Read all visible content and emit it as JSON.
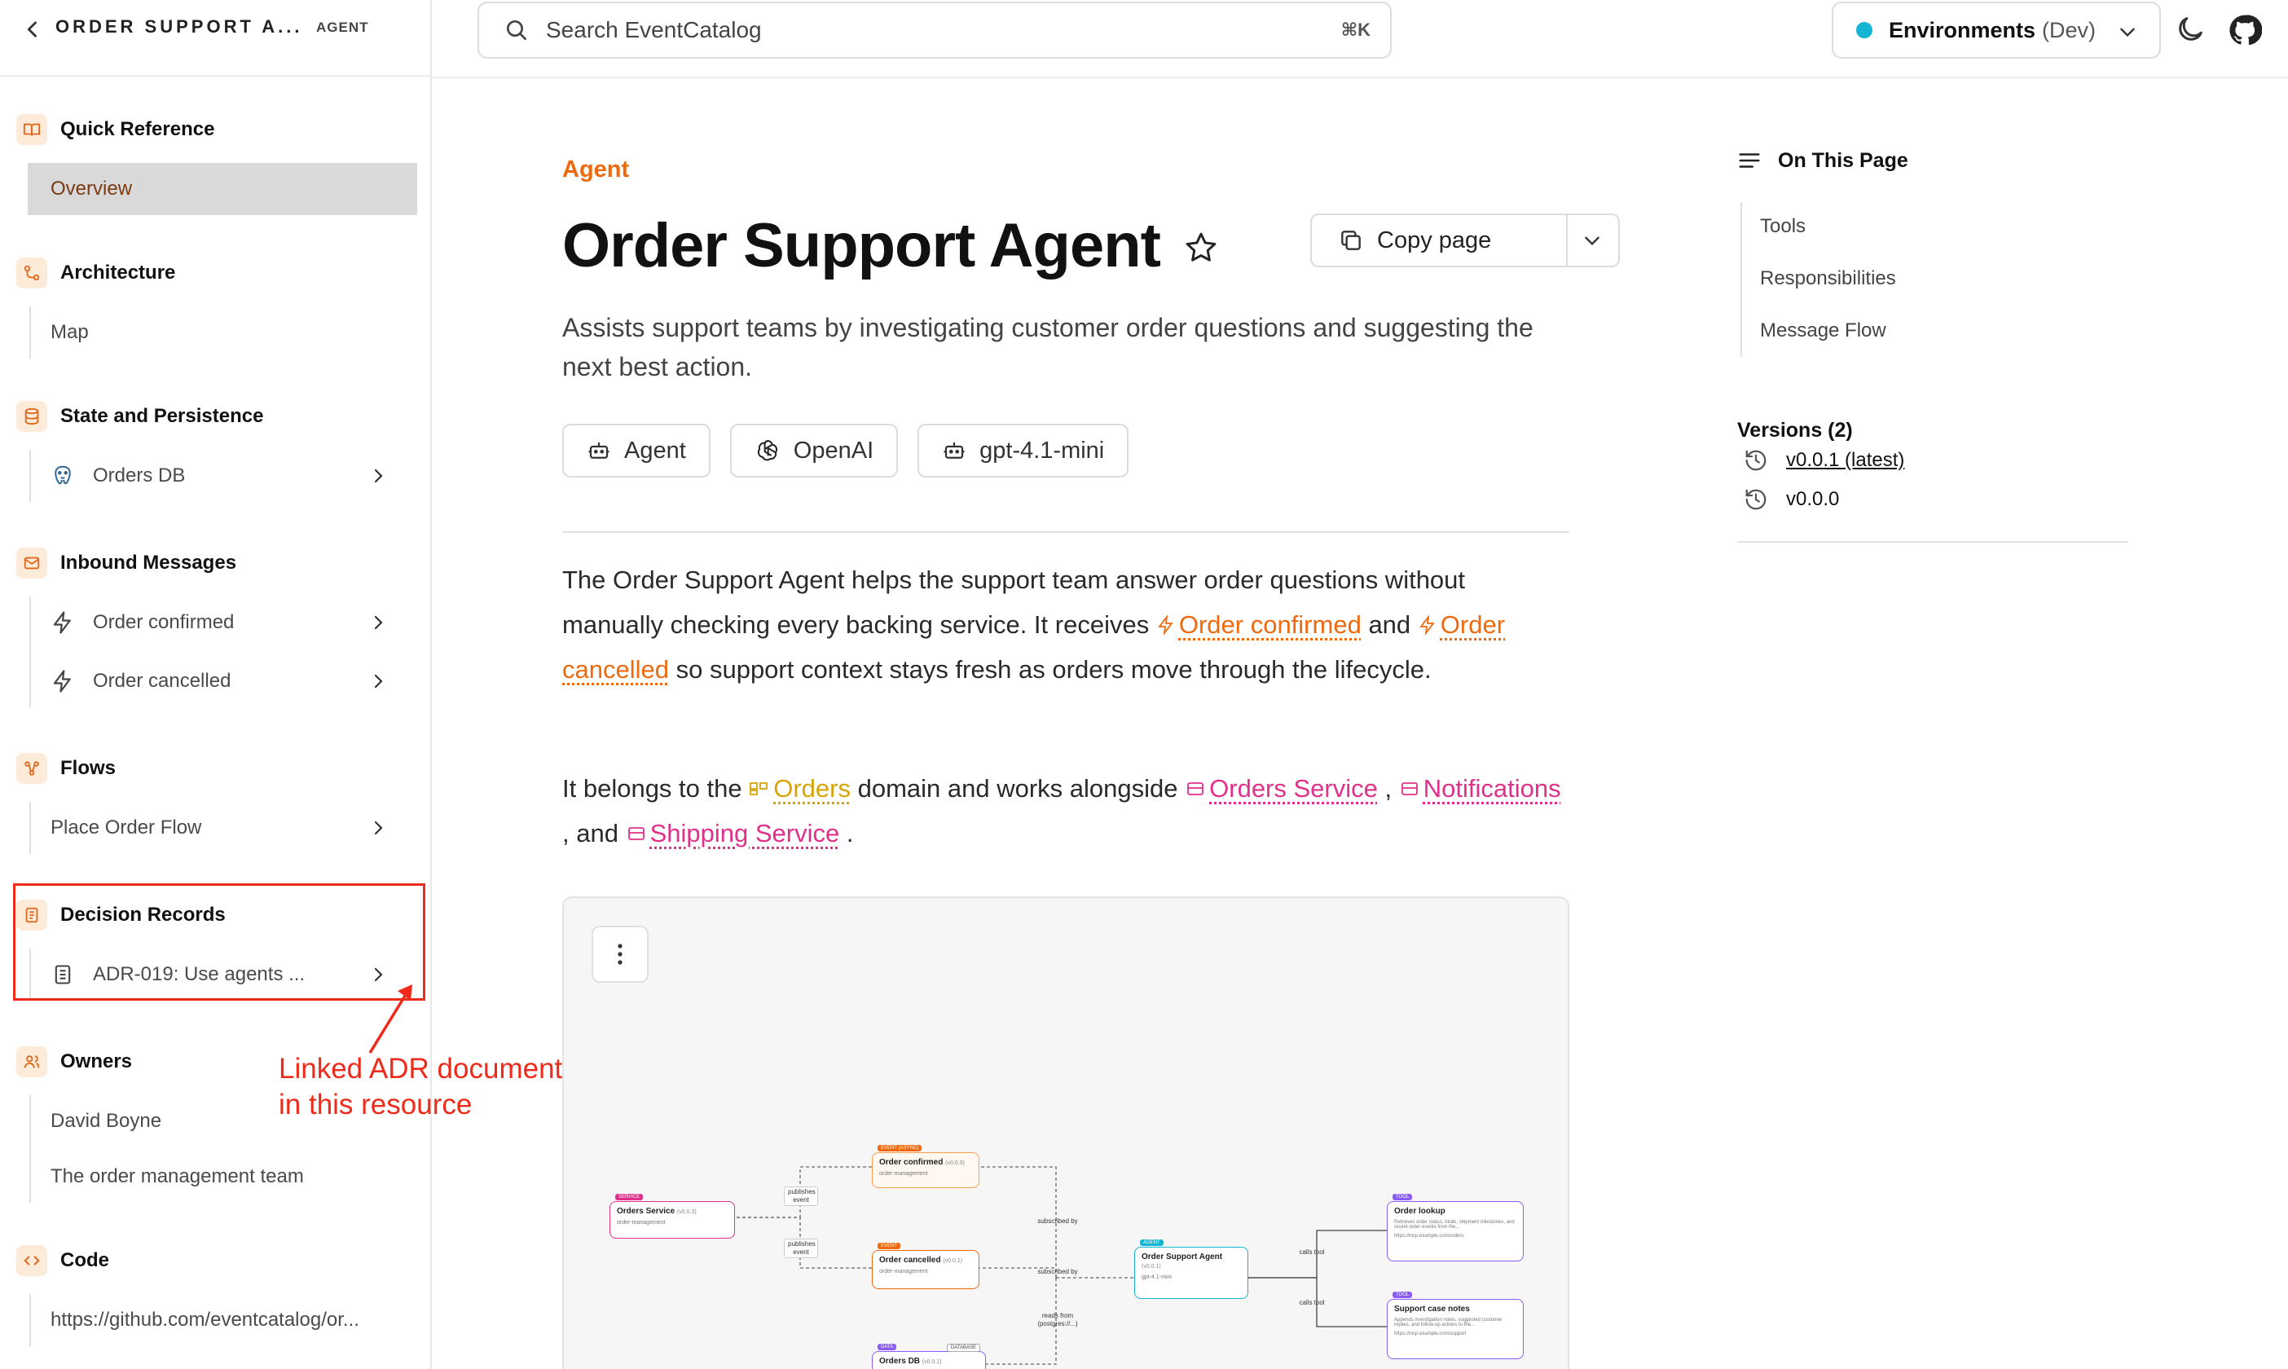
{
  "sidebar": {
    "title": "ORDER SUPPORT A...",
    "badge": "AGENT",
    "sections": {
      "quick_reference": {
        "label": "Quick Reference",
        "items": [
          "Overview"
        ]
      },
      "architecture": {
        "label": "Architecture",
        "items": [
          "Map"
        ]
      },
      "state": {
        "label": "State and Persistence",
        "items": [
          "Orders DB"
        ]
      },
      "inbound": {
        "label": "Inbound Messages",
        "items": [
          "Order confirmed",
          "Order cancelled"
        ]
      },
      "flows": {
        "label": "Flows",
        "items": [
          "Place Order Flow"
        ]
      },
      "decisions": {
        "label": "Decision Records",
        "items": [
          "ADR-019: Use agents ..."
        ]
      },
      "owners": {
        "label": "Owners",
        "items": [
          "David Boyne",
          "The order management team"
        ]
      },
      "code": {
        "label": "Code",
        "items": [
          "https://github.com/eventcatalog/or..."
        ]
      }
    }
  },
  "annotation": {
    "line1": "Linked ADR document",
    "line2": "in this resource",
    "color": "#ee2b1b"
  },
  "topbar": {
    "search_placeholder": "Search EventCatalog",
    "search_shortcut": "⌘K",
    "env_label": "Environments",
    "env_value": "(Dev)"
  },
  "page": {
    "eyebrow": "Agent",
    "title": "Order Support Agent",
    "copy_label": "Copy page",
    "subtitle": "Assists support teams by investigating customer order questions and suggesting the next best action.",
    "pills": [
      "Agent",
      "OpenAI",
      "gpt-4.1-mini"
    ],
    "p1": {
      "a": "The Order Support Agent helps the support team answer order questions without manually checking every backing service. It receives",
      "link1": "Order confirmed",
      "b": "and",
      "link2": "Order cancelled",
      "c": "so support context stays fresh as orders move through the lifecycle."
    },
    "p2": {
      "a": "It belongs to the",
      "domain": "Orders",
      "b": "domain and works alongside",
      "s1": "Orders Service",
      "c": ",",
      "s2": "Notifications",
      "d": ", and",
      "s3": "Shipping Service",
      "e": "."
    }
  },
  "diagram": {
    "nodes": {
      "orders_service": {
        "tag": "SERVICE",
        "title": "Orders Service",
        "ver": "(v0.0.3)",
        "meta": "order-management"
      },
      "order_confirmed": {
        "tag": "EVENT (ASYNC)",
        "title": "Order confirmed",
        "ver": "(v0.0.3)",
        "meta": "order-management"
      },
      "order_cancelled": {
        "tag": "EVENT",
        "title": "Order cancelled",
        "ver": "(v0.0.1)",
        "meta": "order-management"
      },
      "agent": {
        "tag": "AGENT",
        "title": "Order Support Agent",
        "ver": "(v0.0.1)",
        "meta": "gpt-4.1-mini"
      },
      "order_lookup": {
        "tag": "TOOL",
        "title": "Order lookup",
        "meta": "Retrieves order status, totals, shipment milestones, and recent order events from the...",
        "url": "https://mcp.example.com/orders"
      },
      "support_notes": {
        "tag": "TOOL",
        "title": "Support case notes",
        "meta": "Appends investigation notes, suggested customer replies, and follow-up actions to the...",
        "url": "https://mcp.example.com/support"
      },
      "orders_db": {
        "tag": "DATA",
        "title": "Orders DB",
        "ver": "(v0.0.1)",
        "badge": "DATABASE"
      }
    },
    "edges": {
      "publishes1": "publishes event",
      "publishes2": "publishes event",
      "subscribed1": "subscribed by",
      "subscribed2": "subscribed by",
      "reads": "reads from (postgres://...)",
      "calls1": "calls tool",
      "calls2": "calls tool"
    }
  },
  "toc": {
    "title": "On This Page",
    "items": [
      "Tools",
      "Responsibilities",
      "Message Flow"
    ]
  },
  "versions": {
    "title": "Versions (2)",
    "items": [
      "v0.0.1 (latest)",
      "v0.0.0"
    ]
  },
  "colors": {
    "accent": "#ef6a0e",
    "domain_link": "#d9a406",
    "service_link": "#e0318a",
    "env_dot": "#13b5d3"
  }
}
